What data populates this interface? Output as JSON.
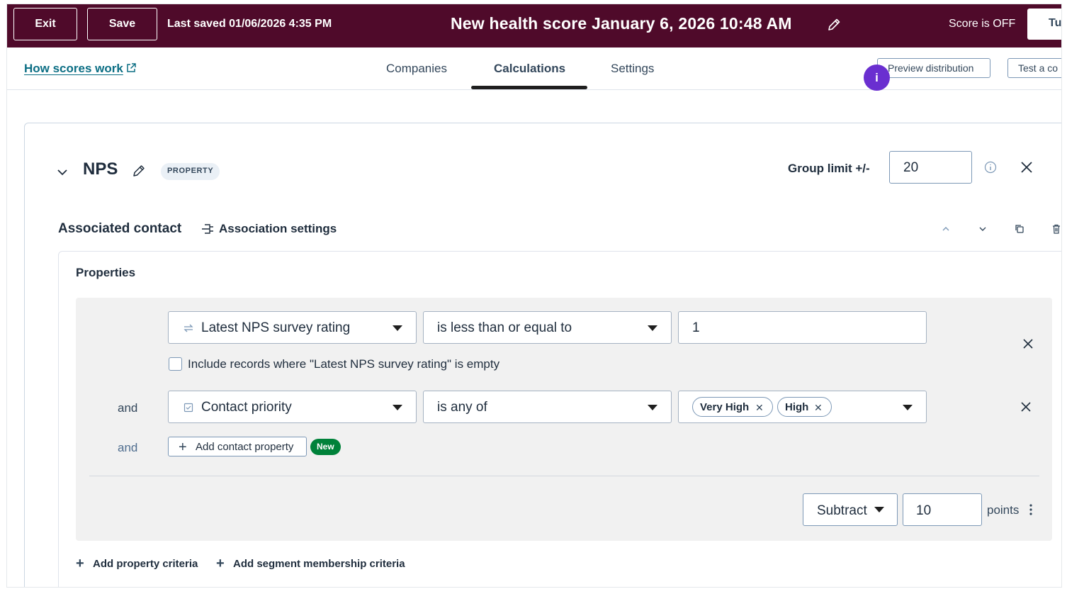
{
  "topbar": {
    "exit_label": "Exit",
    "save_label": "Save",
    "last_saved": "Last saved 01/06/2026 4:35 PM",
    "title": "New health score January 6, 2026 10:48 AM",
    "score_status": "Score is OFF",
    "turn_on_label": "Tu"
  },
  "nav": {
    "how_link": "How scores work",
    "tabs": [
      "Companies",
      "Calculations",
      "Settings"
    ],
    "active_tab": "Calculations",
    "preview_label": "Preview distribution",
    "test_label": "Test a co",
    "info_badge": "i"
  },
  "group": {
    "name": "NPS",
    "badge": "PROPERTY",
    "limit_label": "Group limit +/-",
    "limit_value": "20",
    "association_label": "Associated contact",
    "association_settings": "Association settings",
    "properties_title": "Properties"
  },
  "criteria": {
    "row1": {
      "property": "Latest NPS survey rating",
      "operator": "is less than or equal to",
      "value": "1",
      "include_empty_label": "Include records where \"Latest NPS survey rating\" is empty",
      "include_empty_checked": false
    },
    "row2": {
      "connector": "and",
      "property": "Contact priority",
      "operator": "is any of",
      "values": [
        "Very High",
        "High"
      ]
    },
    "add_row": {
      "connector": "and",
      "add_label": "Add contact property",
      "new_badge": "New"
    },
    "action": {
      "operation": "Subtract",
      "points_value": "10",
      "points_label": "points"
    }
  },
  "footer_links": {
    "add_property_criteria": "Add property criteria",
    "add_segment_criteria": "Add segment membership criteria"
  },
  "colors": {
    "topbar_bg": "#4f0a2a",
    "link": "#0b6e84",
    "new_badge": "#00823a",
    "info_badge": "#6a2fd0"
  }
}
